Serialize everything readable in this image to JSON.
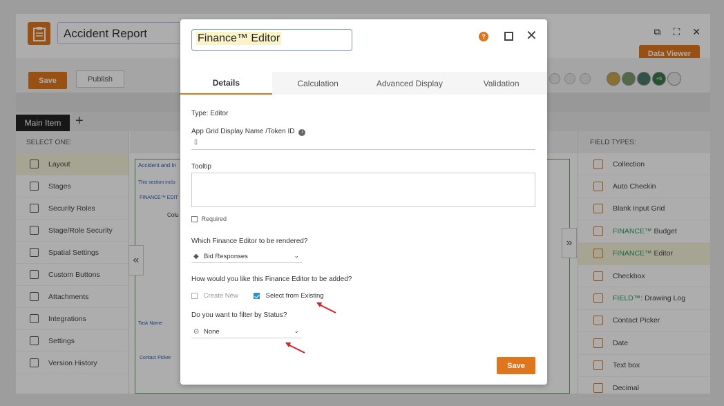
{
  "header": {
    "title": "Accident Report",
    "data_viewer_label": "Data Viewer"
  },
  "toolbar": {
    "save_label": "Save",
    "publish_label": "Publish",
    "avatar_badge": "+5"
  },
  "tabs": {
    "main_item_label": "Main Item"
  },
  "left_panel": {
    "heading": "SELECT ONE:",
    "items": [
      {
        "label": "Layout",
        "icon": "layout-icon"
      },
      {
        "label": "Stages",
        "icon": "stages-icon"
      },
      {
        "label": "Security Roles",
        "icon": "lock-icon"
      },
      {
        "label": "Stage/Role Security",
        "icon": "user-lock-icon"
      },
      {
        "label": "Spatial Settings",
        "icon": "map-icon"
      },
      {
        "label": "Custom Buttons",
        "icon": "wrench-icon"
      },
      {
        "label": "Attachments",
        "icon": "paperclip-icon"
      },
      {
        "label": "Integrations",
        "icon": "integration-icon"
      },
      {
        "label": "Settings",
        "icon": "gear-icon"
      },
      {
        "label": "Version History",
        "icon": "history-icon"
      }
    ]
  },
  "canvas": {
    "section_title": "Accident and In",
    "section_note": "This section inclu",
    "finance_label": "FINANCE™ EDIT",
    "column_label": "Colu",
    "task_name_label": "Task Name",
    "contact_picker_label": "Contact Picker"
  },
  "right_panel": {
    "heading": "FIELD TYPES:",
    "items": [
      {
        "label": "Collection",
        "icon": "plus-icon"
      },
      {
        "label": "Auto Checkin",
        "icon": "crosshair-icon"
      },
      {
        "label": "Blank Input Grid",
        "icon": "grid-icon"
      },
      {
        "label": "FINANCE™ Budget",
        "icon": "finance-icon",
        "green_prefix": "FINANCE™",
        "rest": " Budget"
      },
      {
        "label": "FINANCE™ Editor",
        "icon": "finance-icon",
        "green_prefix": "FINANCE™",
        "rest": " Editor"
      },
      {
        "label": "Checkbox",
        "icon": "checkbox-icon"
      },
      {
        "label": "FIELD™: Drawing Log",
        "icon": "drawing-icon",
        "green_prefix": "FIELD™",
        "rest": ": Drawing Log"
      },
      {
        "label": "Contact Picker",
        "icon": "contact-icon"
      },
      {
        "label": "Date",
        "icon": "calendar-icon"
      },
      {
        "label": "Text box",
        "icon": "textbox-icon"
      },
      {
        "label": "Decimal",
        "icon": "decimal-icon"
      }
    ]
  },
  "modal": {
    "title": "Finance™ Editor",
    "help_glyph": "?",
    "tabs": [
      "Details",
      "Calculation",
      "Advanced Display",
      "Validation"
    ],
    "type_label": "Type: Editor",
    "display_name_label": "App Grid Display Name /Token ID",
    "tooltip_label": "Tooltip",
    "required_label": "Required",
    "which_editor_label": "Which Finance Editor to be rendered?",
    "which_editor_value": "Bid Responses",
    "how_added_label": "How would you like this Finance Editor to be added?",
    "create_new_label": "Create New",
    "select_existing_label": "Select from Existing",
    "filter_status_label": "Do you want to filter by Status?",
    "filter_status_value": "None",
    "save_label": "Save"
  },
  "colors": {
    "accent": "#e0761c",
    "green": "#2a9d5c",
    "checkbox_blue": "#2196d3",
    "annotation_red": "#e02020"
  }
}
